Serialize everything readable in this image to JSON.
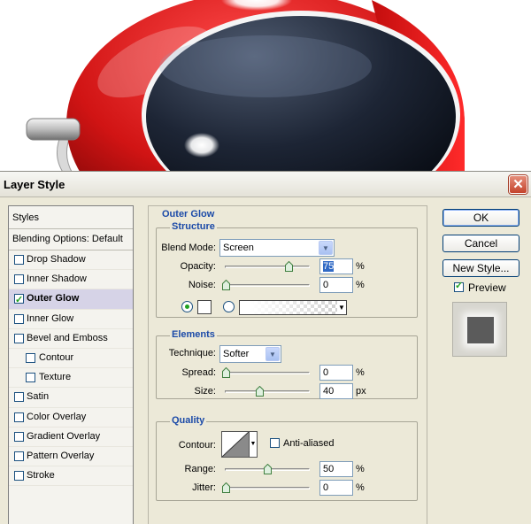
{
  "dialog": {
    "title": "Layer Style",
    "close_glyph": "✕"
  },
  "styles_panel": {
    "header": "Styles",
    "blending_options": "Blending Options: Default",
    "items": [
      {
        "label": "Drop Shadow",
        "checked": false
      },
      {
        "label": "Inner Shadow",
        "checked": false
      },
      {
        "label": "Outer Glow",
        "checked": true,
        "selected": true
      },
      {
        "label": "Inner Glow",
        "checked": false
      },
      {
        "label": "Bevel and Emboss",
        "checked": false
      },
      {
        "label": "Contour",
        "checked": false,
        "indent": true
      },
      {
        "label": "Texture",
        "checked": false,
        "indent": true
      },
      {
        "label": "Satin",
        "checked": false
      },
      {
        "label": "Color Overlay",
        "checked": false
      },
      {
        "label": "Gradient Overlay",
        "checked": false
      },
      {
        "label": "Pattern Overlay",
        "checked": false
      },
      {
        "label": "Stroke",
        "checked": false
      }
    ]
  },
  "outer_glow": {
    "title": "Outer Glow",
    "structure": {
      "title": "Structure",
      "blend_mode_label": "Blend Mode:",
      "blend_mode_value": "Screen",
      "opacity_label": "Opacity:",
      "opacity_value": "75",
      "opacity_level": 75,
      "noise_label": "Noise:",
      "noise_value": "0",
      "noise_level": 0,
      "percent": "%",
      "color_option_selected": "solid-color"
    },
    "elements": {
      "title": "Elements",
      "technique_label": "Technique:",
      "technique_value": "Softer",
      "spread_label": "Spread:",
      "spread_value": "0",
      "spread_level": 0,
      "spread_unit": "%",
      "size_label": "Size:",
      "size_value": "40",
      "size_level": 40,
      "size_unit": "px"
    },
    "quality": {
      "title": "Quality",
      "contour_label": "Contour:",
      "anti_aliased_label": "Anti-aliased",
      "anti_aliased_checked": false,
      "range_label": "Range:",
      "range_value": "50",
      "range_level": 50,
      "range_unit": "%",
      "jitter_label": "Jitter:",
      "jitter_value": "0",
      "jitter_level": 0,
      "jitter_unit": "%"
    }
  },
  "buttons": {
    "ok": "OK",
    "cancel": "Cancel",
    "new_style": "New Style...",
    "preview_label": "Preview",
    "preview_checked": true
  },
  "colors": {
    "accent_blue": "#1b4aa8",
    "dialog_bg": "#ece9d8",
    "selected_item_bg": "#d6d3e7",
    "check_green": "#21a121",
    "artwork_red": "#e51e1e"
  }
}
